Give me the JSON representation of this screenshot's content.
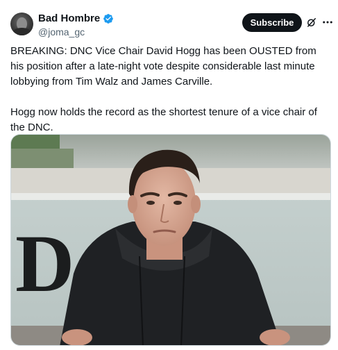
{
  "author": {
    "display_name": "Bad Hombre",
    "handle": "@joma_gc",
    "verified": true
  },
  "actions": {
    "subscribe_label": "Subscribe"
  },
  "icons": {
    "verified": "verified-badge-icon",
    "grok": "grok-icon",
    "more": "more-horizontal-icon"
  },
  "colors": {
    "verified_blue": "#1d9bf0",
    "subscribe_bg": "#0f1419",
    "handle_gray": "#536471"
  },
  "tweet": {
    "paragraphs": [
      "BREAKING: DNC Vice Chair David Hogg has been OUSTED from his position after a late-night vote despite considerable last minute lobbying from Tim Walz and James Carville.",
      "Hogg now holds the record as the shortest tenure of a vice chair of the DNC."
    ]
  },
  "media": {
    "sign_letter": "D"
  }
}
